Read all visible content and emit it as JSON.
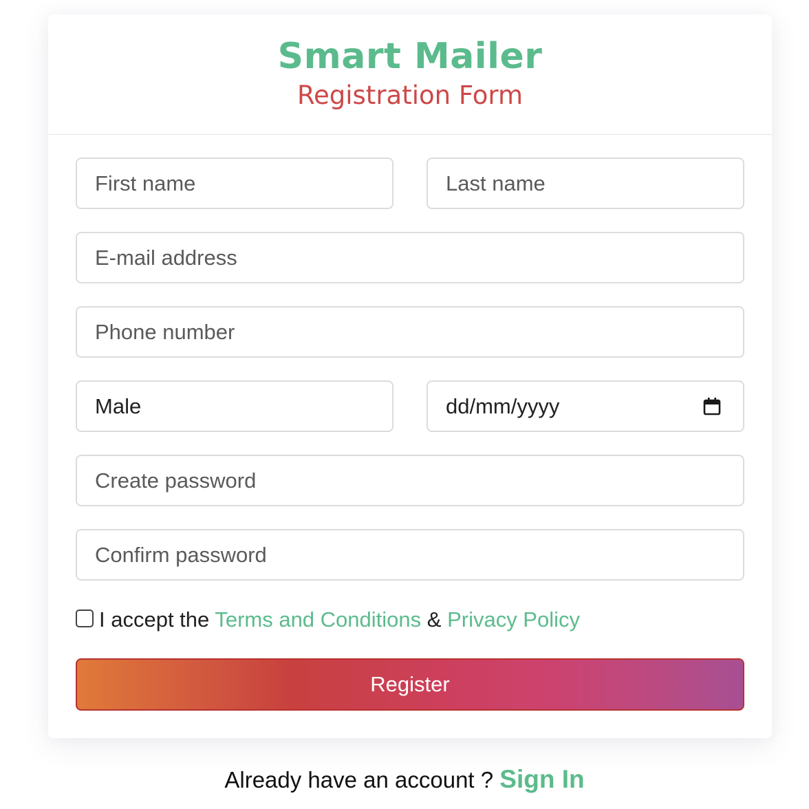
{
  "header": {
    "app_title": "Smart Mailer",
    "form_title": "Registration Form"
  },
  "form": {
    "first_name_placeholder": "First name",
    "last_name_placeholder": "Last name",
    "email_placeholder": "E-mail address",
    "phone_placeholder": "Phone number",
    "gender_value": "Male",
    "dob_placeholder": "dd/mm/yyyy",
    "create_password_placeholder": "Create password",
    "confirm_password_placeholder": "Confirm password",
    "terms_checked": false,
    "terms_prefix": "I accept the ",
    "terms_link": "Terms and Conditions",
    "terms_and": " & ",
    "privacy_link": "Privacy Policy",
    "register_label": "Register"
  },
  "footer": {
    "prompt": "Already have an account ? ",
    "signin_label": "Sign In"
  },
  "colors": {
    "brand_green": "#5bbb8c",
    "subtitle_red": "#cd4848",
    "button_gradient_start": "#e07a39",
    "button_gradient_end": "#a84f93"
  },
  "icons": {
    "date_picker": "calendar-icon"
  }
}
